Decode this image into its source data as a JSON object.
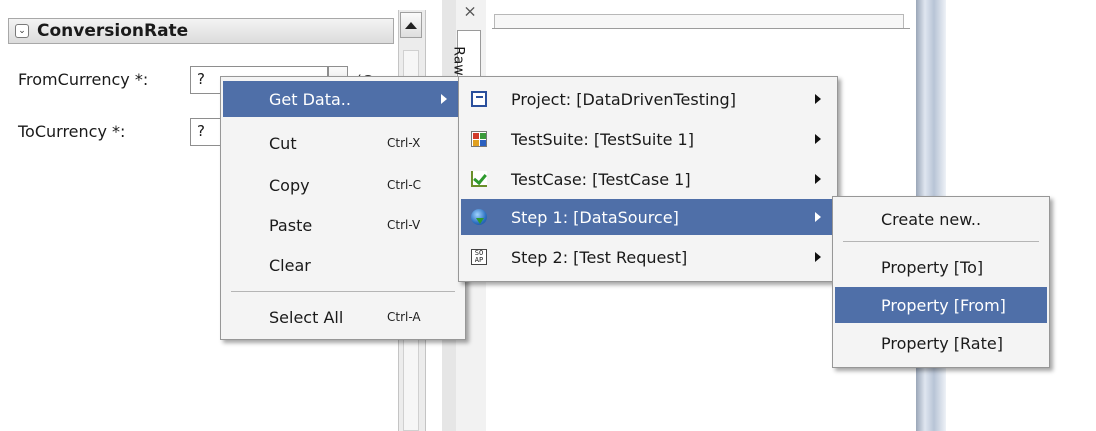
{
  "form": {
    "title": "ConversionRate",
    "fields": [
      {
        "label": "FromCurrency *:",
        "value": "?",
        "suffix": "(C"
      },
      {
        "label": "ToCurrency *:",
        "value": "?"
      }
    ]
  },
  "editor": {
    "raw_tab": "Raw",
    "close_glyph": "×"
  },
  "context_menu": {
    "items": [
      {
        "label": "Get Data..",
        "shortcut": ""
      },
      {
        "label": "Cut",
        "shortcut": "Ctrl-X"
      },
      {
        "label": "Copy",
        "shortcut": "Ctrl-C"
      },
      {
        "label": "Paste",
        "shortcut": "Ctrl-V"
      },
      {
        "label": "Clear",
        "shortcut": ""
      },
      {
        "label": "Select All",
        "shortcut": "Ctrl-A"
      }
    ]
  },
  "getdata_menu": {
    "items": [
      {
        "label": "Project: [DataDrivenTesting]",
        "icon": "project-icon"
      },
      {
        "label": "TestSuite: [TestSuite 1]",
        "icon": "testsuite-icon"
      },
      {
        "label": "TestCase: [TestCase 1]",
        "icon": "testcase-icon"
      },
      {
        "label": "Step 1: [DataSource]",
        "icon": "datasource-icon"
      },
      {
        "label": "Step 2: [Test Request]",
        "icon": "soap-request-icon"
      }
    ],
    "soap_icon_text": "SO\nAP"
  },
  "property_menu": {
    "items": [
      {
        "label": "Create new.."
      },
      {
        "label": "Property [To]"
      },
      {
        "label": "Property [From]"
      },
      {
        "label": "Property [Rate]"
      }
    ]
  },
  "colors": {
    "highlight": "#4f6fa8",
    "menu_bg": "#f4f4f4"
  }
}
